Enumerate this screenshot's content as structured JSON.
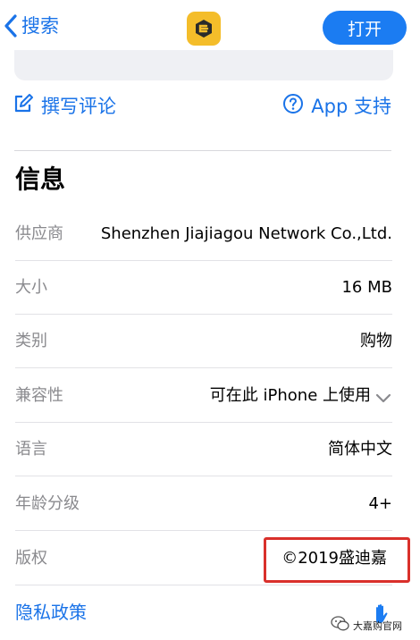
{
  "navbar": {
    "back_label": "搜索",
    "open_label": "打开"
  },
  "actions": {
    "write_review": "撰写评论",
    "app_support": "App 支持"
  },
  "info": {
    "title": "信息",
    "rows": [
      {
        "label": "供应商",
        "value": "Shenzhen Jiajiagou Network Co.,Ltd."
      },
      {
        "label": "大小",
        "value": "16 MB"
      },
      {
        "label": "类别",
        "value": "购物"
      },
      {
        "label": "兼容性",
        "value": "可在此 iPhone 上使用"
      },
      {
        "label": "语言",
        "value": "简体中文"
      },
      {
        "label": "年龄分级",
        "value": "4+"
      },
      {
        "label": "版权",
        "value": "©2019盛迪嘉"
      }
    ]
  },
  "privacy_label": "隐私政策",
  "watermark": "大嘉购官网",
  "colors": {
    "accent": "#1a73e8",
    "open_button": "#1b7cf2",
    "app_icon": "#f4bd2a",
    "highlight": "#d9302b"
  },
  "icons": [
    "chevron-left-icon",
    "app-logo-icon",
    "compose-icon",
    "help-circle-icon",
    "chevron-down-icon",
    "hand-icon",
    "wechat-icon"
  ]
}
